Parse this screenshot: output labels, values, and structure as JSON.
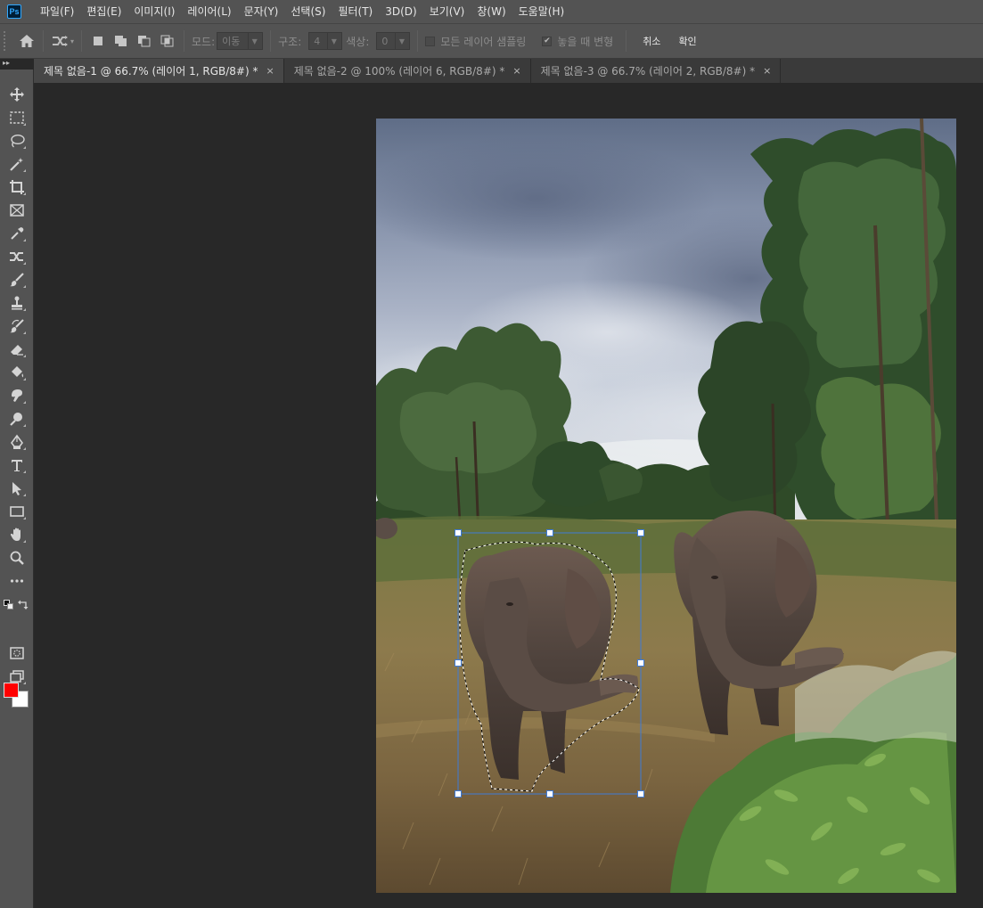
{
  "app": {
    "logo_text": "Ps"
  },
  "menu": [
    "파일(F)",
    "편집(E)",
    "이미지(I)",
    "레이어(L)",
    "문자(Y)",
    "선택(S)",
    "필터(T)",
    "3D(D)",
    "보기(V)",
    "창(W)",
    "도움말(H)"
  ],
  "options": {
    "mode_label": "모드:",
    "mode_value": "이동",
    "structure_label": "구조:",
    "structure_value": "4",
    "color_label": "색상:",
    "color_value": "0",
    "sample_all_label": "모든 레이어 샘플링",
    "transform_on_drop_label": "놓을 때 변형",
    "cancel_label": "취소",
    "ok_label": "확인"
  },
  "tabs": [
    {
      "title": "제목 없음-1 @ 66.7% (레이어 1, RGB/8#) *",
      "active": true
    },
    {
      "title": "제목 없음-2 @ 100% (레이어 6, RGB/8#) *",
      "active": false
    },
    {
      "title": "제목 없음-3 @ 66.7% (레이어 2, RGB/8#) *",
      "active": false
    }
  ],
  "tools": [
    "move-tool-icon",
    "marquee-tool-icon",
    "lasso-tool-icon",
    "magic-wand-tool-icon",
    "crop-tool-icon",
    "frame-tool-icon",
    "eyedropper-tool-icon",
    "content-aware-move-tool-icon",
    "brush-tool-icon",
    "stamp-tool-icon",
    "history-brush-tool-icon",
    "eraser-tool-icon",
    "paint-bucket-tool-icon",
    "smudge-tool-icon",
    "dodge-tool-icon",
    "pen-tool-icon",
    "type-tool-icon",
    "path-selection-tool-icon",
    "rectangle-tool-icon",
    "hand-tool-icon",
    "zoom-tool-icon",
    "more-tools-icon"
  ],
  "colors": {
    "foreground": "#ff0000",
    "background": "#ffffff",
    "ui_dark": "#282828",
    "ui_panel": "#535353",
    "transform_handle": "#1e6fd9"
  },
  "close_glyph": "×",
  "collapse_glyph": "▸▸"
}
